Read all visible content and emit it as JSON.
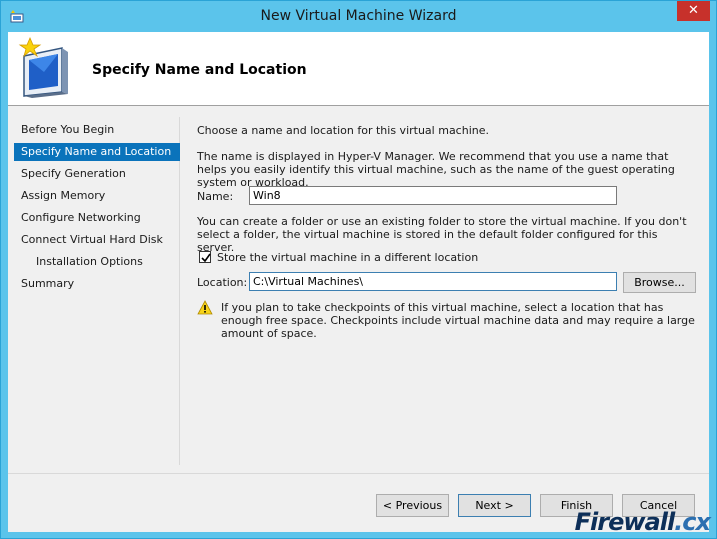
{
  "window": {
    "title": "New Virtual Machine Wizard",
    "close_glyph": "✕"
  },
  "header": {
    "title": "Specify Name and Location",
    "icon": "virtual-machine-wizard-icon"
  },
  "nav": {
    "items": [
      {
        "label": "Before You Begin"
      },
      {
        "label": "Specify Name and Location"
      },
      {
        "label": "Specify Generation"
      },
      {
        "label": "Assign Memory"
      },
      {
        "label": "Configure Networking"
      },
      {
        "label": "Connect Virtual Hard Disk"
      },
      {
        "label": "Installation Options"
      },
      {
        "label": "Summary"
      }
    ]
  },
  "content": {
    "intro": "Choose a name and location for this virtual machine.",
    "name_desc": "The name is displayed in Hyper-V Manager. We recommend that you use a name that helps you easily identify this virtual machine, such as the name of the guest operating system or workload.",
    "name_label": "Name:",
    "name_value": "Win8",
    "folder_desc": "You can create a folder or use an existing folder to store the virtual machine. If you don't select a folder, the virtual machine is stored in the default folder configured for this server.",
    "store_checkbox_label": "Store the virtual machine in a different location",
    "store_checked": true,
    "location_label": "Location:",
    "location_value": "C:\\Virtual Machines\\",
    "browse_label": "Browse...",
    "warning": "If you plan to take checkpoints of this virtual machine, select a location that has enough free space. Checkpoints include virtual machine data and may require a large amount of space."
  },
  "buttons": {
    "previous": "< Previous",
    "next": "Next >",
    "finish": "Finish",
    "cancel": "Cancel"
  },
  "watermark": {
    "main": "Firewall",
    "suffix": ".cx"
  },
  "colors": {
    "titlebar": "#5bc4eb",
    "close": "#c7312b",
    "selection": "#0a73bb"
  }
}
